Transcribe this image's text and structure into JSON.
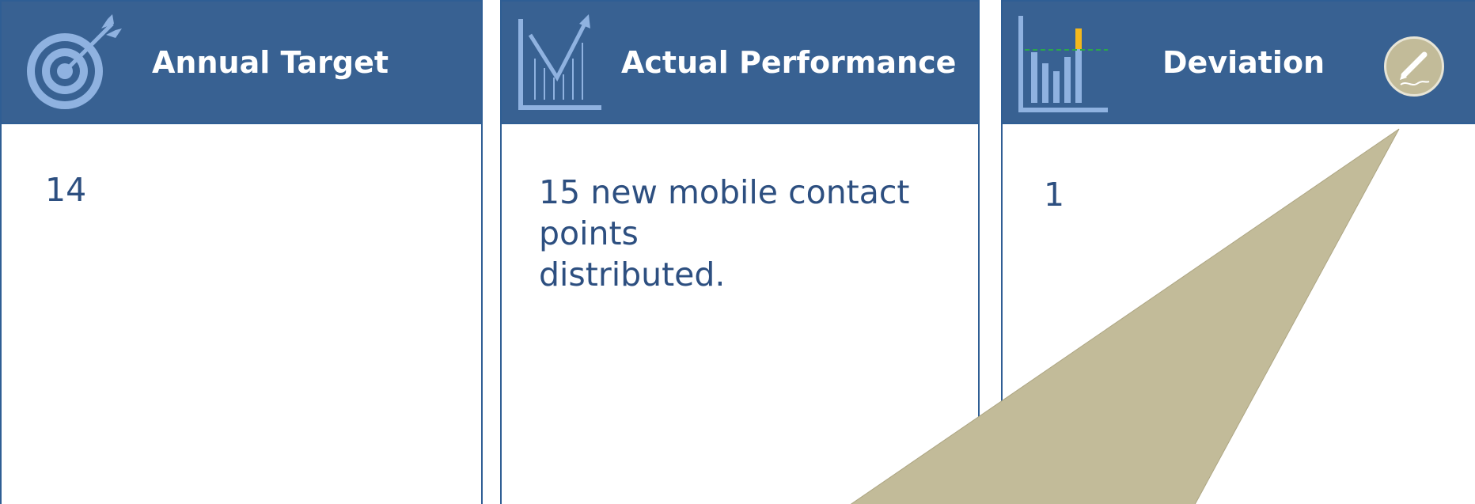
{
  "cards": [
    {
      "title": "Annual Target",
      "value": "14",
      "icon": "target-icon"
    },
    {
      "title": "Actual Performance",
      "value_lines": [
        "15 new mobile contact",
        "points",
        "distributed."
      ],
      "icon": "line-chart-icon"
    },
    {
      "title": "Deviation",
      "value": "1",
      "icon": "bar-chart-icon"
    }
  ],
  "edit_button": {
    "icon": "pen-icon"
  },
  "colors": {
    "header": "#386192",
    "border": "#2f5e94",
    "body_text": "#2d4f80",
    "callout": "#c2bb99",
    "icon_light": "#8fb2e0"
  }
}
